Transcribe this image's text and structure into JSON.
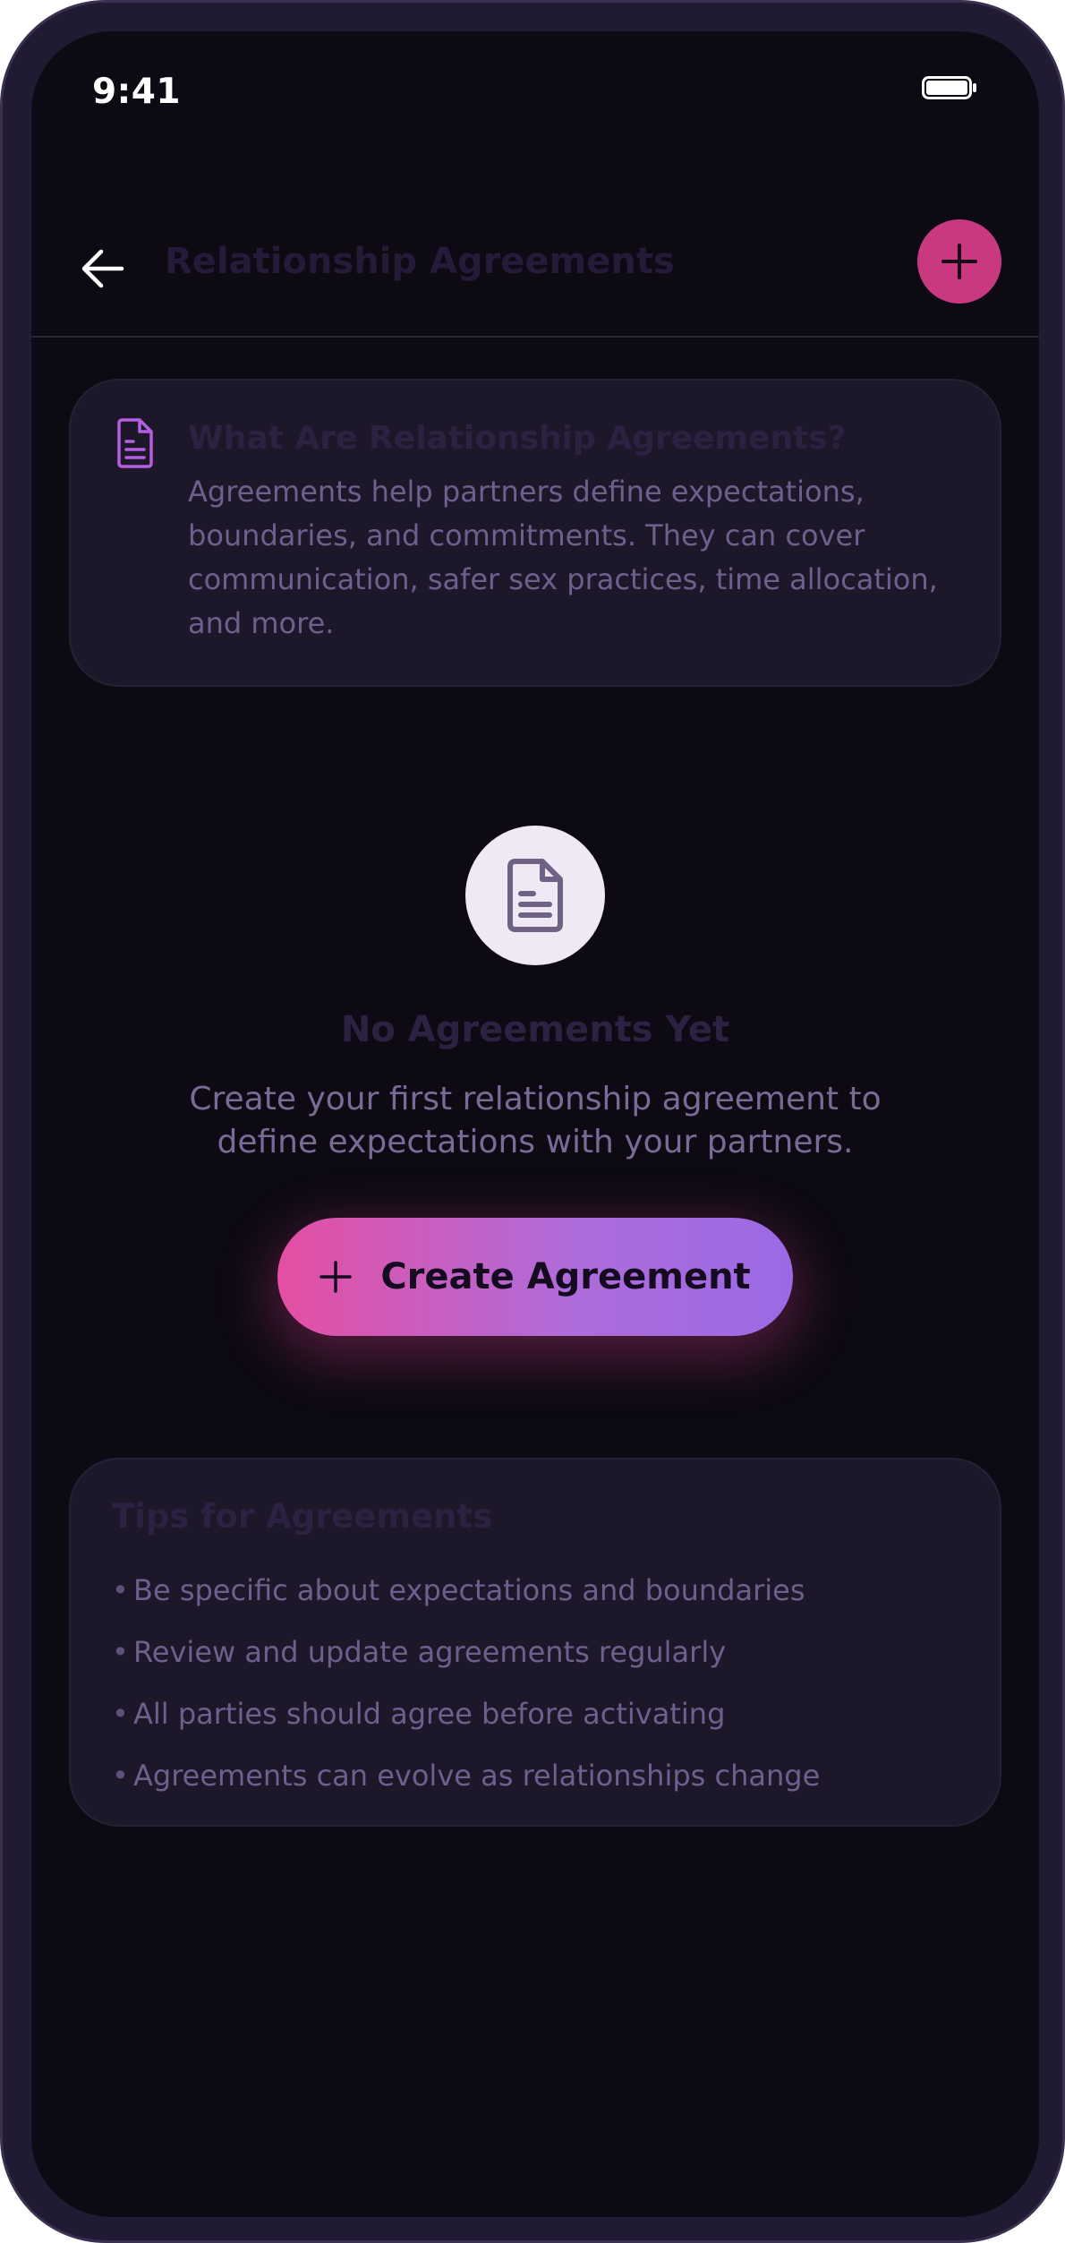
{
  "status_bar": {
    "time": "9:41",
    "battery_icon": "battery-full-icon"
  },
  "header": {
    "title": "Relationship Agreements",
    "back_icon": "arrow-left-icon",
    "add_icon": "plus-icon",
    "add_color": "#c8397f"
  },
  "info_card": {
    "icon": "document-icon",
    "title": "What Are Relationship Agreements?",
    "body": "Agreements help partners define expectations, boundaries, and commitments. They can cover communication, safer sex practices, time allocation, and more."
  },
  "empty_state": {
    "icon": "document-icon",
    "title": "No Agreements Yet",
    "description": "Create your first relationship agreement to define expectations with your partners."
  },
  "create_button": {
    "label": "Create Agreement",
    "icon": "plus-icon",
    "gradient_start": "#e44fa2",
    "gradient_end": "#9a6ae6"
  },
  "tips": {
    "title": "Tips for Agreements",
    "bullet": "•",
    "items": [
      "Be specific about expectations and boundaries",
      "Review and update agreements regularly",
      "All parties should agree before activating",
      "Agreements can evolve as relationships change"
    ]
  }
}
